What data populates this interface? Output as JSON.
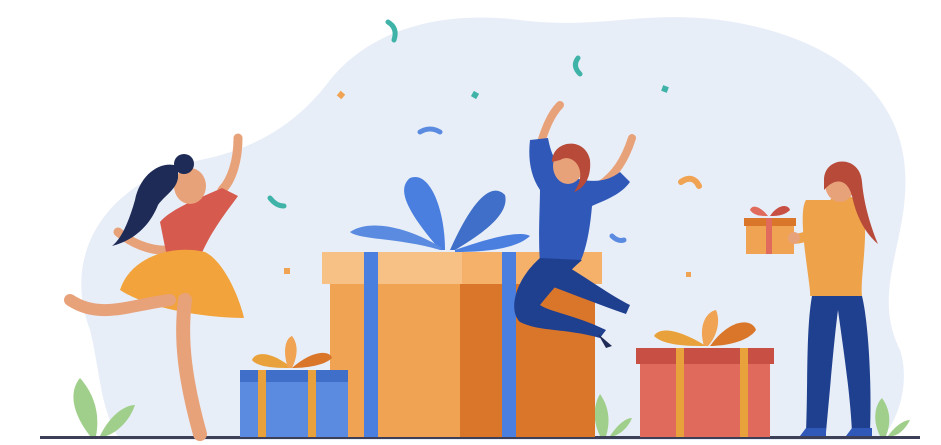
{
  "illustration": {
    "subject": "",
    "colors": {
      "blob": "#e8eef8",
      "ground": "#3d3f56",
      "box_orange": "#f0a352",
      "box_orange_dark": "#d9762a",
      "box_blue": "#5a8be0",
      "box_blue_dark": "#3f6fc8",
      "box_red": "#e06a5c",
      "box_red_dark": "#c84f43",
      "ribbon_blue": "#4a7fe0",
      "ribbon_orange": "#e9a23b",
      "hair_dark": "#1f2b57",
      "hair_red": "#b84a3a",
      "skin": "#e8a27a",
      "shirt_red": "#d65a4e",
      "skirt_orange": "#f2a33c",
      "navy": "#1f3f8f",
      "shirt_orange": "#eea34a",
      "leaf": "#9fcf8a"
    },
    "icons": [
      "confetti-icon",
      "gift-box-icon",
      "leaf-icon"
    ]
  }
}
